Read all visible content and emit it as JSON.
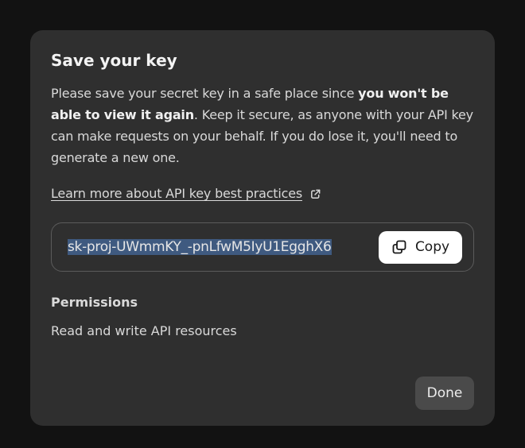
{
  "modal": {
    "title": "Save your key",
    "description_part1": "Please save your secret key in a safe place since ",
    "description_bold": "you won't be able to view it again",
    "description_part2": ". Keep it secure, as anyone with your API key can make requests on your behalf. If you do lose it, you'll need to generate a new one.",
    "learn_more_label": "Learn more about API key best practices",
    "learn_more_icon": "external-link-icon",
    "key_value": "sk-proj-UWmmKY_-pnLfwM5IyU1EgghX6",
    "copy_label": "Copy",
    "copy_icon": "copy-icon",
    "permissions_title": "Permissions",
    "permissions_value": "Read and write API resources",
    "done_label": "Done"
  },
  "colors": {
    "page_background": "#121212",
    "modal_background": "#2f2f2f",
    "selection_highlight": "#3f5a80",
    "copy_button_background": "#ffffff",
    "done_button_background": "#4a4a4a"
  }
}
